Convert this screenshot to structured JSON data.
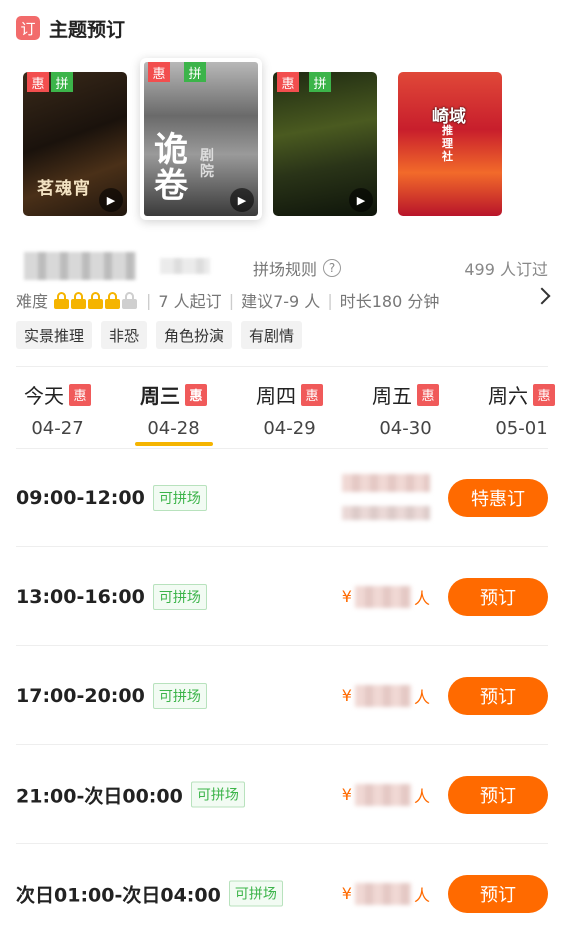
{
  "header": {
    "icon_char": "订",
    "title": "主题预订"
  },
  "posters": [
    {
      "badges": [
        "惠",
        "拼"
      ],
      "title_text": "茗魂宵"
    },
    {
      "badges": [
        "惠",
        "拼"
      ],
      "title_text": "诡卷",
      "subtitle": "剧院"
    },
    {
      "badges": [
        "惠",
        "拼"
      ]
    },
    {
      "badges": [],
      "title_text": "崎域",
      "subtitle": "推理社"
    }
  ],
  "info": {
    "rules_label": "拼场规则",
    "booked": "499 人订过",
    "difficulty_label": "难度",
    "difficulty_level": 4,
    "difficulty_max": 5,
    "min_people": "7 人起订",
    "suggest": "建议7-9 人",
    "duration": "时长180 分钟"
  },
  "tags": [
    "实景推理",
    "非恐",
    "角色扮演",
    "有剧情"
  ],
  "dates": [
    {
      "name": "今天",
      "badge": "惠",
      "date": "04-27"
    },
    {
      "name": "周三",
      "badge": "惠",
      "date": "04-28"
    },
    {
      "name": "周四",
      "badge": "惠",
      "date": "04-29"
    },
    {
      "name": "周五",
      "badge": "惠",
      "date": "04-30"
    },
    {
      "name": "周六",
      "badge": "惠",
      "date": "05-01"
    }
  ],
  "active_date_index": 1,
  "slots": [
    {
      "time": "09:00-12:00",
      "badge": "可拼场",
      "button": "特惠订"
    },
    {
      "time": "13:00-16:00",
      "badge": "可拼场",
      "price_prefix": "¥",
      "price_suffix": "人",
      "button": "预订"
    },
    {
      "time": "17:00-20:00",
      "badge": "可拼场",
      "price_prefix": "¥",
      "price_suffix": "人",
      "button": "预订"
    },
    {
      "time": "21:00-次日00:00",
      "badge": "可拼场",
      "price_prefix": "¥",
      "price_suffix": "人",
      "button": "预订"
    },
    {
      "time": "次日01:00-次日04:00",
      "badge": "可拼场",
      "price_prefix": "¥",
      "price_suffix": "人",
      "button": "预订"
    }
  ],
  "colors": {
    "accent": "#ff6a00",
    "badge_red": "#f24e4e",
    "badge_green": "#3cb44a",
    "underline": "#f5b400"
  }
}
